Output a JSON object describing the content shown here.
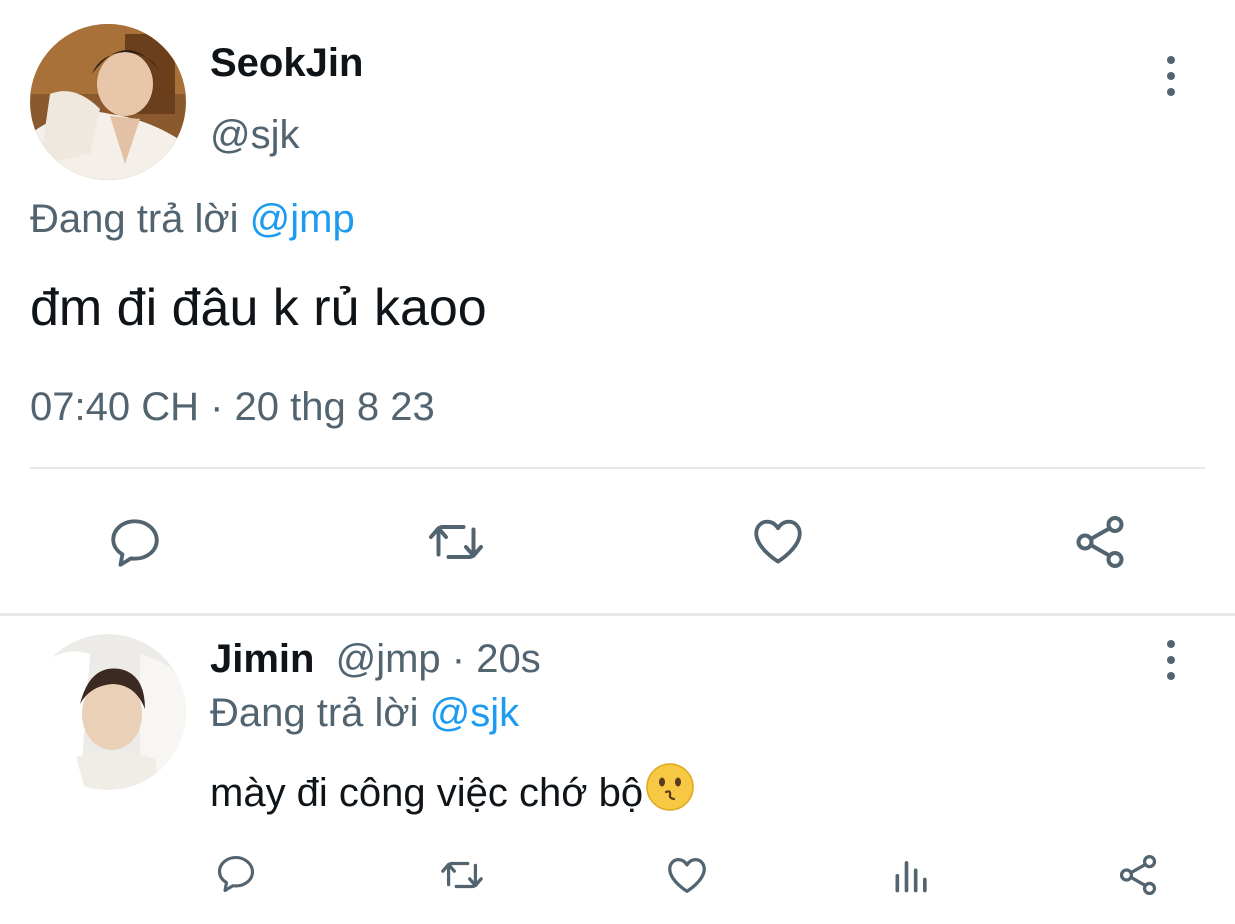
{
  "main_tweet": {
    "display_name": "SeokJin",
    "handle": "@sjk",
    "replying_prefix": "Đang trả lời",
    "replying_to": "@jmp",
    "text": "đm đi đâu k rủ kaoo",
    "timestamp": "07:40 CH · 20 thg 8 23",
    "actions": [
      "reply-icon",
      "retweet-icon",
      "like-icon",
      "share-icon"
    ]
  },
  "reply_tweet": {
    "display_name": "Jimin",
    "handle_time": "@jmp · 20s",
    "replying_prefix": "Đang trả lời",
    "replying_to": "@sjk",
    "text": "mày đi công việc chớ bộ",
    "emoji": "kissing-face",
    "actions": [
      "reply-icon",
      "retweet-icon",
      "like-icon",
      "views-icon",
      "share-icon"
    ]
  },
  "colors": {
    "text": "#0f1419",
    "secondary": "#536471",
    "link": "#1d9bf0",
    "divider": "#e6e9eb"
  }
}
